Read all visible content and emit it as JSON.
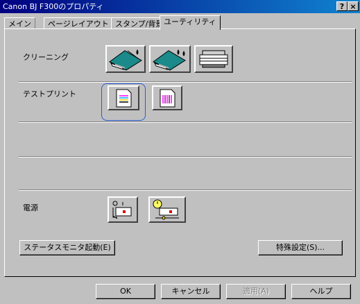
{
  "window": {
    "title": "Canon BJ F300のプロパティ",
    "help_btn": "?",
    "close_btn": "×"
  },
  "tabs": [
    {
      "label": "メイン"
    },
    {
      "label": "ページレイアウト"
    },
    {
      "label": "スタンプ/背景"
    },
    {
      "label": "ユーティリティ",
      "active": true
    }
  ],
  "sections": {
    "cleaning": "クリーニング",
    "test_print": "テストプリント",
    "power": "電源"
  },
  "buttons": {
    "status_monitor": "ステータスモニタ起動(E)",
    "special_settings": "特殊設定(S)...",
    "ok": "OK",
    "cancel": "キャンセル",
    "apply": "適用(A)",
    "help": "ヘルプ"
  },
  "icons": {
    "cleaning": "cleaning-icon",
    "deep_cleaning": "deep-cleaning-icon",
    "head_alignment": "head-alignment-icon",
    "nozzle_check": "nozzle-check-icon",
    "print_head_alignment": "print-head-alignment-icon",
    "power_off": "power-off-icon",
    "auto_power": "auto-power-icon"
  }
}
